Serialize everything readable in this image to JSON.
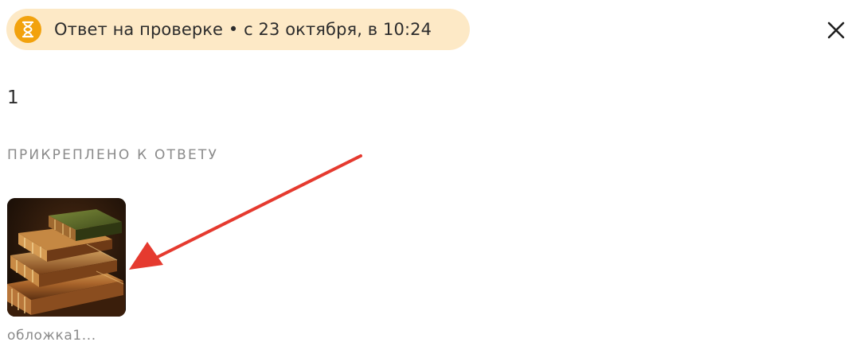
{
  "status": {
    "icon": "hourglass-icon",
    "text": "Ответ на проверке • с 23 октября, в 10:24",
    "pill_color": "#fde9c6",
    "icon_color": "#f2a20d"
  },
  "close": {
    "icon": "close-icon"
  },
  "answer": {
    "text": "1"
  },
  "attachments": {
    "label": "ПРИКРЕПЛЕНО К ОТВЕТУ",
    "items": [
      {
        "name": "обложка1...",
        "preview": "books-image"
      }
    ]
  },
  "annotation": {
    "icon": "red-arrow-icon",
    "color": "#e53a2f"
  }
}
